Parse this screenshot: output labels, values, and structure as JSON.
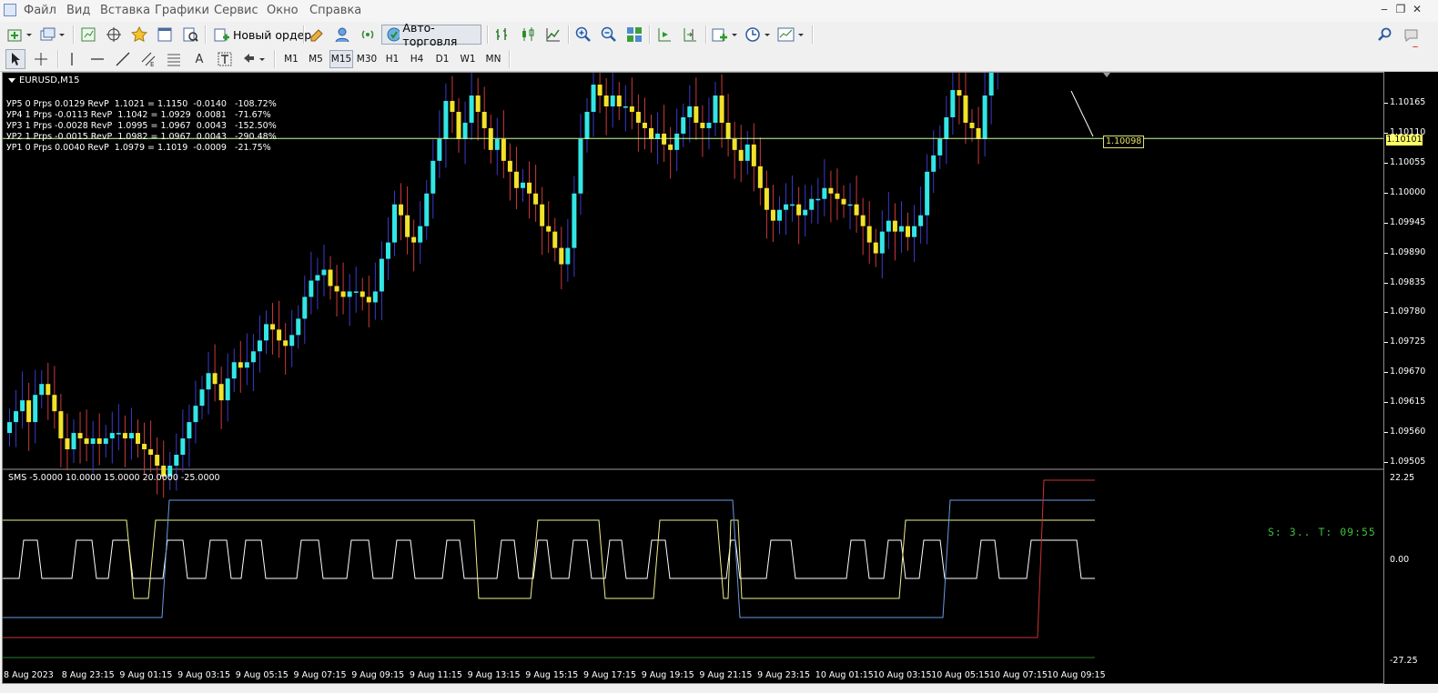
{
  "menu": {
    "items": [
      "Файл",
      "Вид",
      "Вставка",
      "Графики",
      "Сервис",
      "Окно",
      "Справка"
    ]
  },
  "toolbar": {
    "new_order_label": "Новый ордер",
    "autotrading_label": "Авто-торговля",
    "notification_count": "1",
    "timeframes": [
      "M1",
      "M5",
      "M15",
      "M30",
      "H1",
      "H4",
      "D1",
      "W1",
      "MN"
    ],
    "active_timeframe": "M15",
    "text_tool_label": "A"
  },
  "chart": {
    "title": "EURUSD,M15",
    "yp_lines": [
      "УР5 0 Prps 0.0129 RevP  1.1021 = 1.1150  -0.0140   -108.72%",
      "УР4 1 Prps -0.0113 RevP  1.1042 = 1.0929  0.0081   -71.67%",
      "УР3 1 Prps -0.0028 RevP  1.0995 = 1.0967  0.0043   -152.50%",
      "УР2 1 Prps -0.0015 RevP  1.0982 = 1.0967  0.0043   -290.48%",
      "УР1 0 Prps 0.0040 RevP  1.0979 = 1.1019  -0.0009   -21.75%"
    ],
    "status": "S: 3.. T: 09:55",
    "sms_label": "SMS -5.0000 10.0000 15.0000 20.0000 -25.0000",
    "current_price": "1.10101",
    "line_price_tag": "1.10098",
    "price_labels": [
      "1.10165",
      "1.10110",
      "1.10055",
      "1.10000",
      "1.09945",
      "1.09890",
      "1.09835",
      "1.09780",
      "1.09725",
      "1.09670",
      "1.09615",
      "1.09560",
      "1.09505"
    ],
    "indicator_labels": [
      "22.25",
      "0.00",
      "-27.25"
    ],
    "time_labels": [
      "8 Aug 2023",
      "8 Aug 23:15",
      "9 Aug 01:15",
      "9 Aug 03:15",
      "9 Aug 05:15",
      "9 Aug 07:15",
      "9 Aug 09:15",
      "9 Aug 11:15",
      "9 Aug 13:15",
      "9 Aug 15:15",
      "9 Aug 17:15",
      "9 Aug 19:15",
      "9 Aug 21:15",
      "9 Aug 23:15",
      "10 Aug 01:15",
      "10 Aug 03:15",
      "10 Aug 05:15",
      "10 Aug 07:15",
      "10 Aug 09:15"
    ]
  },
  "colors": {
    "bull": "#33e6e6",
    "bear": "#f2e22a",
    "wick_up": "#3a3acc",
    "wick_down": "#cc3a3a",
    "price_line": "#ccff99",
    "sms_white": "#ffffff",
    "sms_yellow": "#f0f08c",
    "sms_blue": "#6a9ae0",
    "sms_red": "#cc3333",
    "sms_green": "#2e7d32"
  },
  "chart_data": {
    "type": "candlestick",
    "symbol": "EURUSD",
    "timeframe": "M15",
    "ylim": [
      1.09505,
      1.10165
    ],
    "closes": [
      1.0958,
      1.096,
      1.0962,
      1.0958,
      1.0963,
      1.0965,
      1.0963,
      1.096,
      1.0955,
      1.0953,
      1.0956,
      1.0955,
      1.0954,
      1.0955,
      1.0954,
      1.0955,
      1.0956,
      1.0956,
      1.0955,
      1.0956,
      1.0954,
      1.0953,
      1.0952,
      1.095,
      1.0948,
      1.095,
      1.0952,
      1.0955,
      1.0958,
      1.0961,
      1.0964,
      1.0967,
      1.0965,
      1.0962,
      1.0966,
      1.0969,
      1.0968,
      1.0969,
      1.0971,
      1.0973,
      1.0976,
      1.0975,
      1.0973,
      1.0972,
      1.0974,
      1.0977,
      1.0981,
      1.0984,
      1.0985,
      1.0986,
      1.0983,
      1.0982,
      1.0981,
      1.0982,
      1.0982,
      1.0981,
      1.098,
      1.0982,
      1.0988,
      1.0991,
      1.0998,
      1.0996,
      1.0992,
      1.0991,
      1.0994,
      1.1,
      1.1006,
      1.101,
      1.1017,
      1.1015,
      1.101,
      1.1013,
      1.1018,
      1.1015,
      1.1012,
      1.1008,
      1.101,
      1.1006,
      1.1004,
      1.1001,
      1.1002,
      1.1,
      1.0998,
      1.0994,
      1.0993,
      1.099,
      1.0987,
      1.099,
      1.1,
      1.101,
      1.1015,
      1.102,
      1.1018,
      1.1016,
      1.1018,
      1.1016,
      1.1016,
      1.1015,
      1.1013,
      1.1012,
      1.101,
      1.1011,
      1.1009,
      1.1008,
      1.1011,
      1.1014,
      1.1016,
      1.1013,
      1.1012,
      1.1013,
      1.1018,
      1.1013,
      1.101,
      1.1008,
      1.1006,
      1.1009,
      1.1005,
      1.1001,
      1.0997,
      1.0995,
      1.0997,
      1.0998,
      1.0998,
      1.0996,
      1.0997,
      1.0999,
      1.0999,
      1.1001,
      1.1,
      1.0999,
      1.0998,
      1.0998,
      1.0996,
      1.0994,
      1.0991,
      1.0989,
      1.0993,
      1.0995,
      1.0993,
      1.0994,
      1.0992,
      1.0994,
      1.0996,
      1.1004,
      1.1007,
      1.101,
      1.1014,
      1.1019,
      1.1018,
      1.1013,
      1.1012,
      1.101,
      1.1018,
      1.1023,
      1.1031,
      1.1034,
      1.1037,
      1.1043,
      1.1048,
      1.1052,
      1.1045,
      1.1055,
      1.1066,
      1.108,
      1.1093,
      1.1098,
      1.1102,
      1.1102,
      1.1102,
      1.1103
    ],
    "indicator": {
      "name": "SMS",
      "params": [
        -5.0,
        10.0,
        15.0,
        20.0,
        -25.0
      ],
      "ylim": [
        -27.25,
        22.25
      ]
    }
  }
}
